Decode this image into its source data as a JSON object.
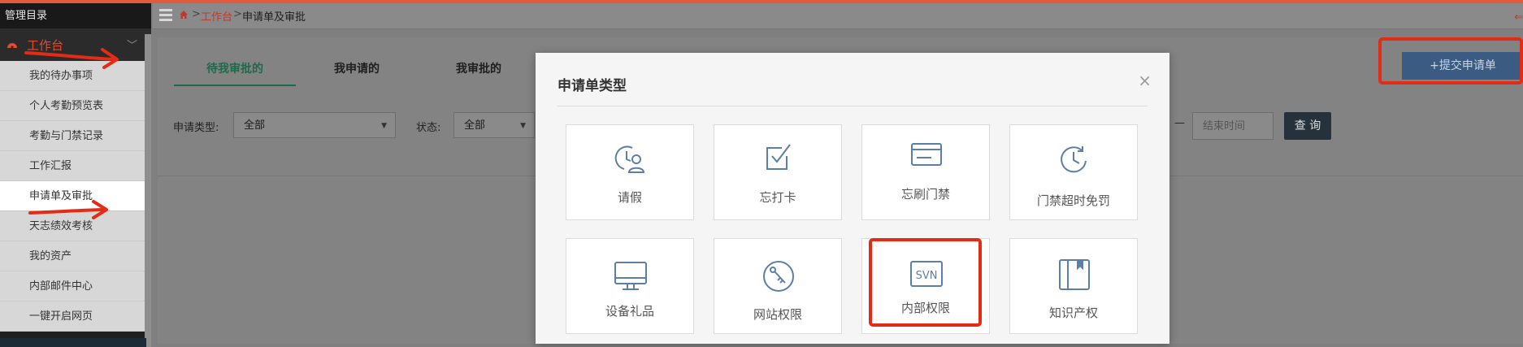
{
  "sidebar": {
    "header": "管理目录",
    "group_label": "工作台",
    "items": [
      {
        "label": "我的待办事项"
      },
      {
        "label": "个人考勤预览表"
      },
      {
        "label": "考勤与门禁记录"
      },
      {
        "label": "工作汇报"
      },
      {
        "label": "申请单及审批"
      },
      {
        "label": "天志绩效考核"
      },
      {
        "label": "我的资产"
      },
      {
        "label": "内部邮件中心"
      },
      {
        "label": "一键开启网页"
      }
    ]
  },
  "breadcrumb": {
    "level1": "工作台",
    "level2": "申请单及审批"
  },
  "tabs": [
    {
      "label": "待我审批的"
    },
    {
      "label": "我申请的"
    },
    {
      "label": "我审批的"
    }
  ],
  "filters": {
    "type_label": "申请类型:",
    "type_value": "全部",
    "status_label": "状态:",
    "status_value": "全部",
    "end_time_placeholder": "结束时间",
    "range_dash": "—",
    "query_label": "查 询"
  },
  "submit_button": "+提交申请单",
  "modal": {
    "title": "申请单类型",
    "close": "×",
    "cards": [
      {
        "label": "请假",
        "icon": "leave-icon"
      },
      {
        "label": "忘打卡",
        "icon": "check-in-icon"
      },
      {
        "label": "忘刷门禁",
        "icon": "access-card-icon"
      },
      {
        "label": "门禁超时免罚",
        "icon": "clock-icon"
      },
      {
        "label": "设备礼品",
        "icon": "monitor-icon"
      },
      {
        "label": "网站权限",
        "icon": "key-icon"
      },
      {
        "label": "内部权限",
        "icon": "svn-icon",
        "icon_text": "SVN"
      },
      {
        "label": "知识产权",
        "icon": "book-icon"
      }
    ]
  },
  "colors": {
    "accent_red": "#e32b16",
    "tab_active": "#1d6b4a",
    "icon_blue": "#5b7fa6"
  }
}
